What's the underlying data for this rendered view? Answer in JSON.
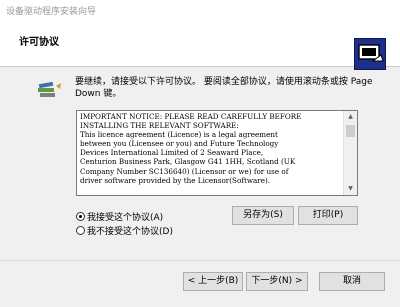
{
  "window": {
    "title": "设备驱动程序安装向导"
  },
  "header": {
    "title": "许可协议"
  },
  "instruction": "要继续，请接受以下许可协议。 要阅读全部协议，请使用滚动条或按 Page Down 键。",
  "license": {
    "text": "IMPORTANT NOTICE: PLEASE READ CAREFULLY BEFORE\nINSTALLING THE RELEVANT SOFTWARE:\nThis licence agreement (Licence) is a legal agreement\nbetween you (Licensee or you) and Future Technology\nDevices International Limited of 2 Seaward Place,\nCenturion Business Park, Glasgow G41 1HH, Scotland (UK\nCompany Number SC136640) (Licensor or we) for use of\ndriver software provided by the Licensor(Software)."
  },
  "buttons": {
    "save_as": "另存为(S)",
    "print": "打印(P)",
    "back": "< 上一步(B)",
    "next": "下一步(N) >",
    "cancel": "取消"
  },
  "options": {
    "accept": "我接受这个协议(A)",
    "decline": "我不接受这个协议(D)",
    "selected": "accept"
  },
  "icons": {
    "header_logo": "installer-wizard-icon",
    "info": "books-icon"
  }
}
